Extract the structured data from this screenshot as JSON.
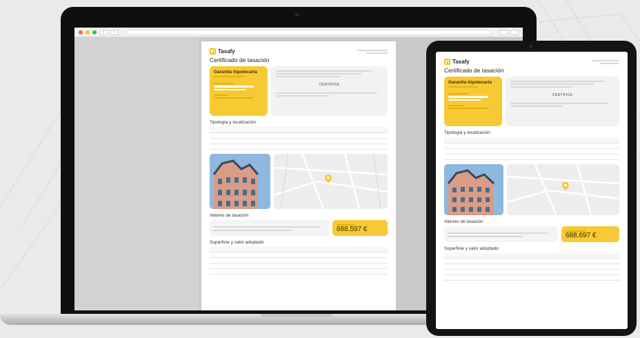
{
  "browser": {
    "nav_back": "‹",
    "nav_forward": "›",
    "traffic_colors": [
      "#ff5f57",
      "#febc2e",
      "#28c840"
    ]
  },
  "colors": {
    "accent": "#f6c935",
    "background": "#e9eaec"
  },
  "doc": {
    "brand": "Tasafy",
    "title": "Certificado de tasación",
    "card_title": "Garantía hipotecaria",
    "certifica": "CERTIFICA",
    "section_tipologia": "Tipología y localización",
    "section_valores": "Valores de tasación",
    "section_superficie": "Superficie y valor adoptado",
    "laptop_value": "688.597 €",
    "tablet_value": "688.697 €"
  },
  "icons": {
    "logo": "tasafy-logo-icon",
    "map_pin": "map-pin-icon"
  }
}
